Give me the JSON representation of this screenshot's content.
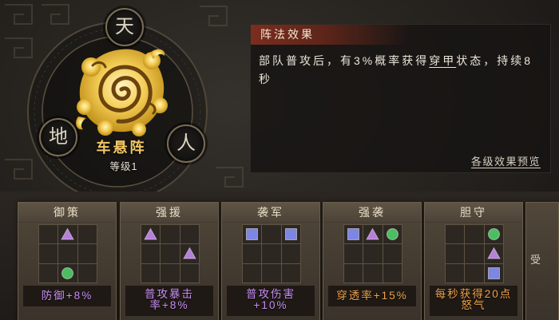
{
  "formation": {
    "name": "车悬阵",
    "level": "等级1",
    "icon": "golden-swirl-icon",
    "seals": [
      {
        "glyph": "天"
      },
      {
        "glyph": "地"
      },
      {
        "glyph": "人"
      }
    ]
  },
  "effect": {
    "header": "阵法效果",
    "desc_pre": "部队普攻后，有3%概率获得",
    "desc_keyword": "穿甲",
    "desc_post": "状态，持续8秒",
    "preview_link": "各级效果预览"
  },
  "markers": {
    "triangle": "#b67fd9",
    "circle": "#4cbd63",
    "square": "#7e86e3"
  },
  "label_colors": {
    "purple": "#c98ff2",
    "orange": "#f2a44a"
  },
  "cards": [
    {
      "title": "御策",
      "slots": [
        "",
        "triangle",
        "",
        "",
        "",
        "",
        "",
        "circle",
        ""
      ],
      "label": "防御+8%",
      "label_color": "purple"
    },
    {
      "title": "强援",
      "slots": [
        "triangle",
        "",
        "",
        "",
        "",
        "triangle",
        "",
        "",
        ""
      ],
      "label": "普攻暴击率+8%",
      "label_color": "purple"
    },
    {
      "title": "袭军",
      "slots": [
        "square",
        "",
        "square",
        "",
        "",
        "",
        "",
        "",
        ""
      ],
      "label": "普攻伤害+10%",
      "label_color": "purple"
    },
    {
      "title": "强袭",
      "slots": [
        "square",
        "triangle",
        "circle",
        "",
        "",
        "",
        "",
        "",
        ""
      ],
      "label": "穿透率+15%",
      "label_color": "orange"
    },
    {
      "title": "胆守",
      "slots": [
        "",
        "",
        "circle",
        "",
        "",
        "triangle",
        "",
        "",
        "square"
      ],
      "label": "每秒获得20点怒气",
      "label_color": "orange"
    },
    {
      "partial_text": "受"
    }
  ]
}
